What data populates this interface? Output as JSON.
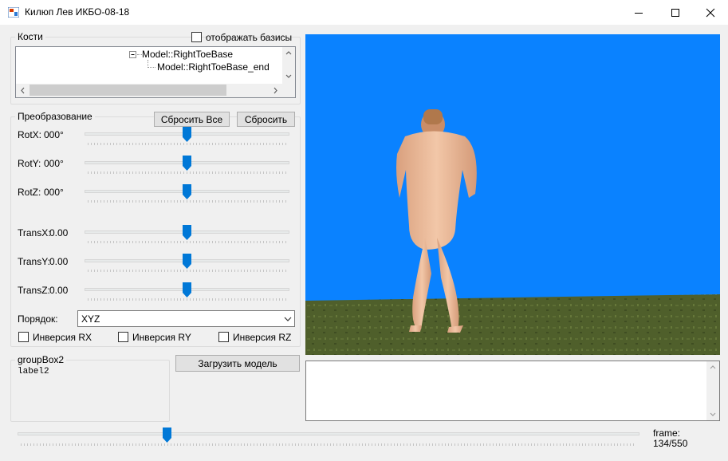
{
  "window": {
    "title": "Килюп Лев ИКБО-08-18"
  },
  "bones": {
    "group_title": "Кости",
    "show_bases_label": "отображать базисы",
    "show_bases_checked": false,
    "tree_items": [
      "Model::RightToeBase",
      "Model::RightToeBase_end"
    ]
  },
  "transform": {
    "group_title": "Преобразование",
    "reset_all_label": "Сбросить Все",
    "reset_label": "Сбросить",
    "sliders": [
      {
        "label": "RotX:",
        "value": "000°",
        "position": 0.5
      },
      {
        "label": "RotY:",
        "value": "000°",
        "position": 0.5
      },
      {
        "label": "RotZ:",
        "value": "000°",
        "position": 0.5
      },
      {
        "label": "TransX:",
        "value": "0.00",
        "position": 0.5
      },
      {
        "label": "TransY:",
        "value": "0.00",
        "position": 0.5
      },
      {
        "label": "TransZ:",
        "value": "0.00",
        "position": 0.5
      }
    ],
    "order_label": "Порядок:",
    "order_value": "XYZ",
    "inversions": [
      {
        "label": "Инверсия RX",
        "checked": false
      },
      {
        "label": "Инверсия RY",
        "checked": false
      },
      {
        "label": "Инверсия RZ",
        "checked": false
      }
    ]
  },
  "group2": {
    "title": "groupBox2",
    "label": "label2"
  },
  "load_model_label": "Загрузить модель",
  "frame": {
    "label": "frame:",
    "value": "134/550",
    "position": 0.24
  },
  "colors": {
    "sky": "#0a82ff",
    "ground": "#4e5e2a",
    "accent": "#0078d7"
  }
}
